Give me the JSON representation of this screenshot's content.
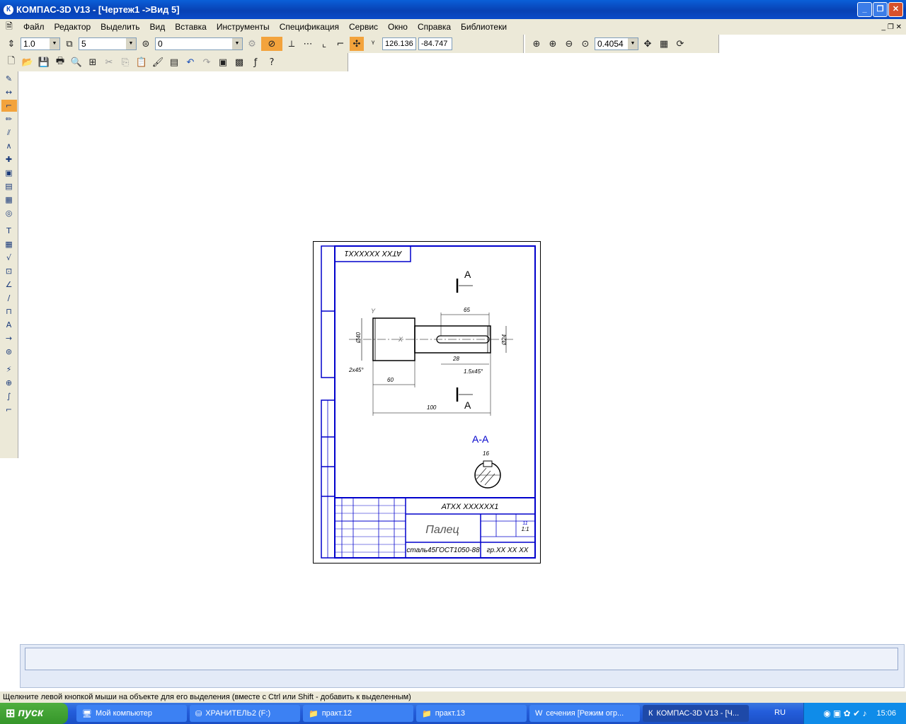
{
  "window": {
    "title": "КОМПАС-3D V13 - [Чертеж1 ->Вид 5]"
  },
  "menu": {
    "items": [
      "Файл",
      "Редактор",
      "Выделить",
      "Вид",
      "Вставка",
      "Инструменты",
      "Спецификация",
      "Сервис",
      "Окно",
      "Справка",
      "Библиотеки"
    ]
  },
  "toolbar": {
    "step": "1.0",
    "view_number": "5",
    "layer": "0",
    "coord_x": "126.136",
    "coord_y": "-84.747",
    "zoom": "0.4054"
  },
  "drawing": {
    "stamp_code_rotated": "АТХХ ХХХХХХ1",
    "section_mark": "А",
    "section_title": "А-А",
    "dims": {
      "d65": "65",
      "d40": "Ø40",
      "d24": "Ø24",
      "d28": "28",
      "d2x45a": "2х45°",
      "d1_5x45": "1.5х45°",
      "d60": "60",
      "d100": "100",
      "d16": "16"
    },
    "title_block": {
      "code": "АТХХ ХХХХХХ1",
      "name": "Палец",
      "material": "сталь45ГОСТ1050-88",
      "group": "гр.ХХ ХХ ХХ",
      "scale": "1:1",
      "number": "11"
    }
  },
  "status": {
    "hint": "Щелкните левой кнопкой мыши на объекте для его выделения (вместе с Ctrl или Shift - добавить к выделенным)"
  },
  "taskbar": {
    "start": "пуск",
    "tasks": [
      "Мой компьютер",
      "ХРАНИТЕЛЬ2 (F:)",
      "практ.12",
      "практ.13",
      "сечения [Режим огр...",
      "КОМПАС-3D V13 - [Ч..."
    ],
    "lang": "RU",
    "clock": "15:06"
  }
}
